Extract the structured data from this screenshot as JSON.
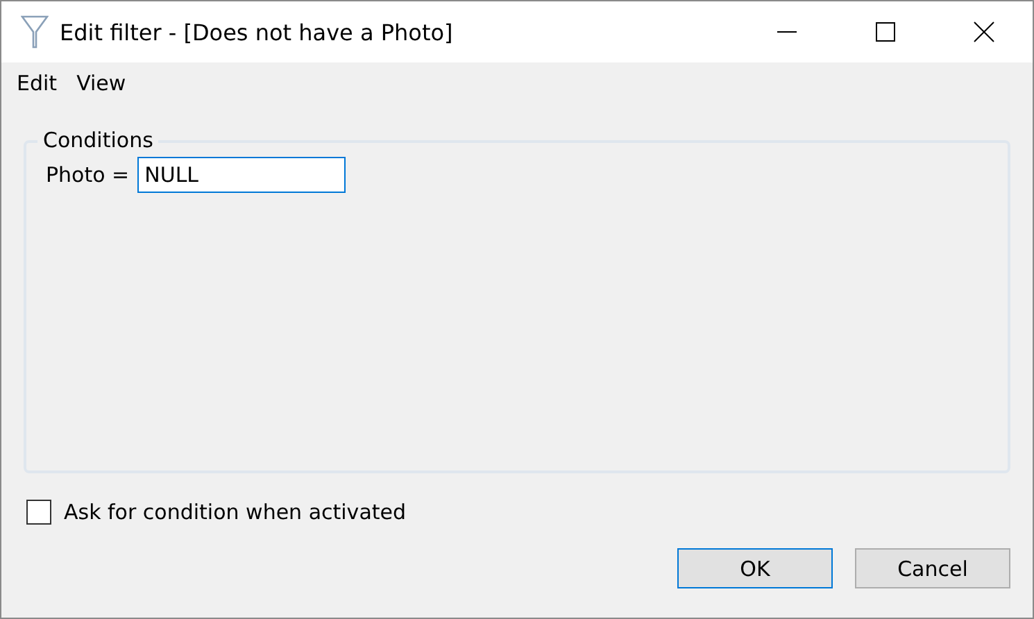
{
  "window": {
    "title": "Edit filter - [Does not have a Photo]"
  },
  "menu": [
    "Edit",
    "View"
  ],
  "conditions": {
    "title": "Conditions",
    "rows": [
      {
        "label": "Photo =",
        "value": "NULL",
        "focused": true
      }
    ]
  },
  "ask_checkbox": {
    "label": "Ask for condition when activated",
    "checked": false
  },
  "buttons": [
    {
      "label": "OK",
      "default": true
    },
    {
      "label": "Cancel",
      "default": false
    }
  ]
}
